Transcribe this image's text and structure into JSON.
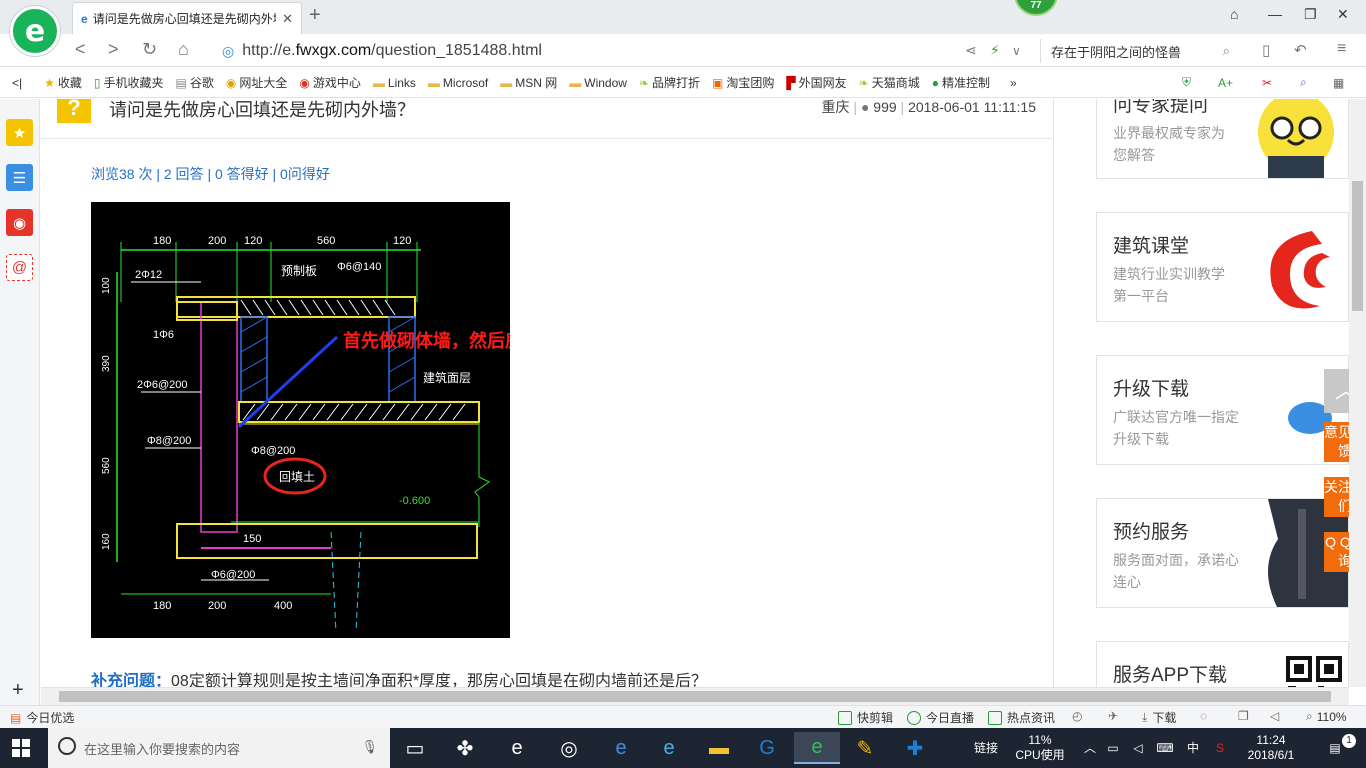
{
  "browser": {
    "tab_title": "请问是先做房心回填还是先砌内外墙",
    "badge": "77",
    "url_prefix": "http://e.",
    "url_domain": "fwxgx.com",
    "url_path": "/question_1851488.html",
    "search_text": "存在于阴阳之间的怪兽"
  },
  "bookmarks": [
    {
      "icon": "star-icon",
      "label": "收藏"
    },
    {
      "icon": "phone-icon",
      "label": "手机收藏夹"
    },
    {
      "icon": "doc-icon",
      "label": "谷歌"
    },
    {
      "icon": "globe-icon",
      "label": "网址大全"
    },
    {
      "icon": "game-icon",
      "label": "游戏中心"
    },
    {
      "icon": "folder-icon",
      "label": "Links"
    },
    {
      "icon": "folder-icon",
      "label": "Microsof"
    },
    {
      "icon": "folder-icon",
      "label": "MSN 网"
    },
    {
      "icon": "folder-icon",
      "label": "Window"
    },
    {
      "icon": "leaf-icon",
      "label": "品牌打折"
    },
    {
      "icon": "tao-icon",
      "label": "淘宝团购"
    },
    {
      "icon": "flag-icon",
      "label": "外国网友"
    },
    {
      "icon": "leaf-icon",
      "label": "天猫商城"
    },
    {
      "icon": "chat-icon",
      "label": "精准控制"
    }
  ],
  "question": {
    "title": "请问是先做房心回填还是先砌内外墙？",
    "region": "重庆",
    "user": "999",
    "date": "2018-06-01 11:11:15",
    "stats": "浏览38 次 | 2 回答 | 0 答得好 | 0问得好",
    "supplement_label": "补充问题：",
    "supplement_text": "08定额计算规则是按主墙间净面积*厚度，那房心回填是在砌内墙前还是后？"
  },
  "drawing": {
    "dims_top": [
      "180",
      "200",
      "120",
      "560",
      "120"
    ],
    "dims_bottom": [
      "180",
      "200",
      "400"
    ],
    "dims_left": [
      "100",
      "390",
      "560",
      "160"
    ],
    "labels": {
      "rebar1": "2Φ12",
      "precast": "预制板",
      "rebar2": "Φ6@140",
      "rebar3": "1Φ6",
      "rebar4": "2Φ6@200",
      "floor": "建筑面层",
      "rebar5": "Φ8@200",
      "rebar6": "Φ8@200",
      "backfill": "回填土",
      "elev": "-0.600",
      "dim150": "150",
      "rebar7": "Φ6@200",
      "note": "首先做砌体墙，然后房心回填"
    }
  },
  "sidebar": [
    {
      "title": "问专家提问",
      "desc": "业界最权威专家为您解答"
    },
    {
      "title": "建筑课堂",
      "desc": "建筑行业实训教学第一平台"
    },
    {
      "title": "升级下载",
      "desc": "广联达官方唯一指定升级下载"
    },
    {
      "title": "预约服务",
      "desc": "服务面对面，承诺心连心"
    },
    {
      "title": "服务APP下载",
      "desc": ""
    }
  ],
  "float_buttons": [
    {
      "label": "意见反馈"
    },
    {
      "label": "关注我们"
    },
    {
      "label": "Q Q咨询"
    }
  ],
  "statusbar": {
    "left": "今日优选",
    "items": [
      "快剪辑",
      "今日直播",
      "热点资讯",
      "下载"
    ],
    "zoom": "110%"
  },
  "taskbar": {
    "search_placeholder": "在这里输入你要搜索的内容",
    "link_label": "链接",
    "cpu_pct": "11%",
    "cpu_label": "CPU使用",
    "ime": "中",
    "time": "11:24",
    "date": "2018/6/1",
    "notifications": "1"
  }
}
